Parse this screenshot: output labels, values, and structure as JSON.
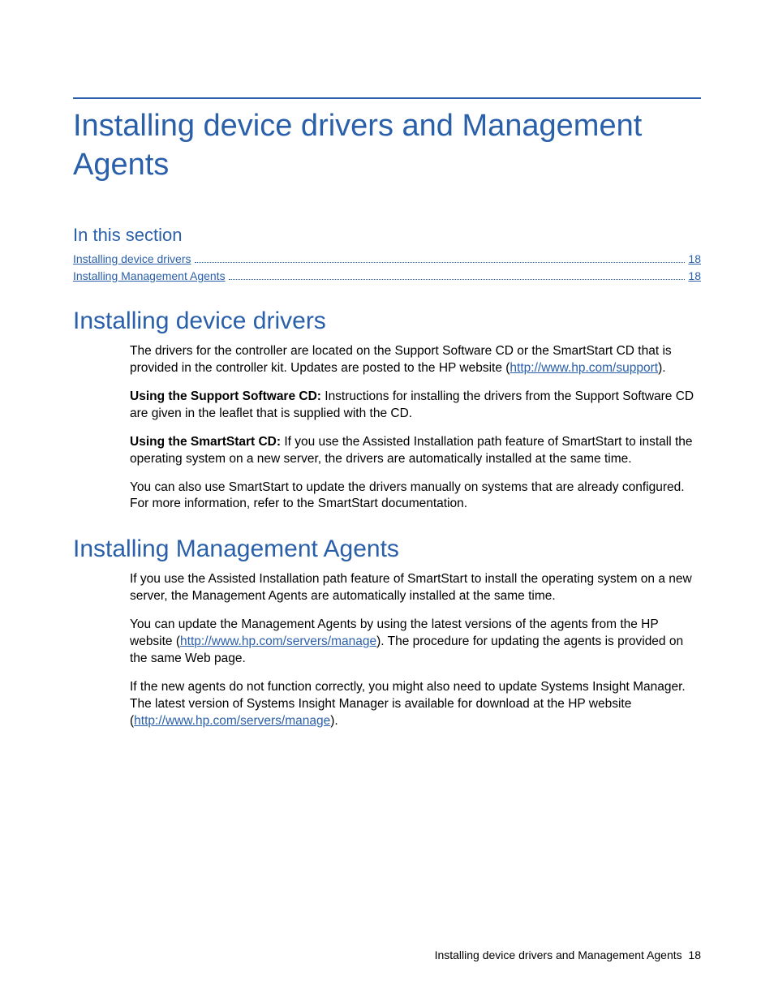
{
  "title": "Installing device drivers and Management Agents",
  "in_this_section_label": "In this section",
  "toc": [
    {
      "title": "Installing device drivers",
      "page": "18"
    },
    {
      "title": "Installing Management Agents",
      "page": "18"
    }
  ],
  "section1": {
    "heading": "Installing device drivers",
    "p1a": "The drivers for the controller are located on the Support Software CD or the SmartStart CD that is provided in the controller kit. Updates are posted to the HP website (",
    "p1_link": "http://www.hp.com/support",
    "p1b": ").",
    "p2_bold": "Using the Support Software CD:",
    "p2_rest": " Instructions for installing the drivers from the Support Software CD are given in the leaflet that is supplied with the CD.",
    "p3_bold": "Using the SmartStart CD:",
    "p3_rest": " If you use the Assisted Installation path feature of SmartStart to install the operating system on a new server, the drivers are automatically installed at the same time.",
    "p4": "You can also use SmartStart to update the drivers manually on systems that are already configured. For more information, refer to the SmartStart documentation."
  },
  "section2": {
    "heading": "Installing Management Agents",
    "p1": "If you use the Assisted Installation path feature of SmartStart to install the operating system on a new server, the Management Agents are automatically installed at the same time.",
    "p2a": "You can update the Management Agents by using the latest versions of the agents from the HP website (",
    "p2_link": "http://www.hp.com/servers/manage",
    "p2b": "). The procedure for updating the agents is provided on the same Web page.",
    "p3a": "If the new agents do not function correctly, you might also need to update Systems Insight Manager. The latest version of Systems Insight Manager is available for download at the HP website (",
    "p3_link": "http://www.hp.com/servers/manage",
    "p3b": ")."
  },
  "footer": {
    "text": "Installing device drivers and Management Agents",
    "page": "18"
  }
}
